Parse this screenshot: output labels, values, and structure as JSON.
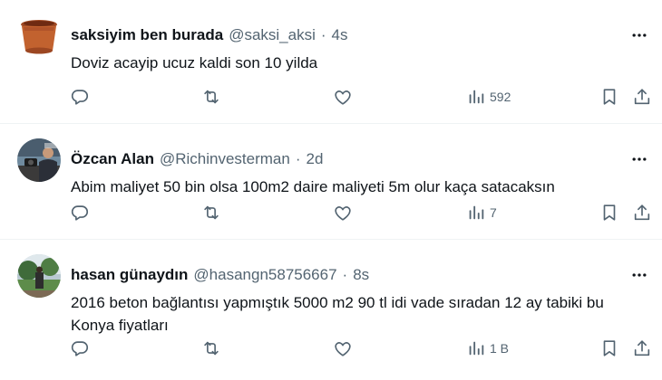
{
  "tweets": [
    {
      "name": "saksiyim ben burada",
      "handle": "@saksi_aksi",
      "sep": "·",
      "time": "4s",
      "text": "Doviz acayip ucuz kaldi son 10 yilda",
      "views": "592",
      "avatar": "flower-pot-avatar"
    },
    {
      "name": "Özcan Alan",
      "handle": "@Richinvesterman",
      "sep": "·",
      "time": "2d",
      "text": "Abim maliyet 50 bin olsa 100m2 daire maliyeti 5m olur kaça satacaksın",
      "views": "7",
      "avatar": "man-with-camera-avatar"
    },
    {
      "name": "hasan günaydın",
      "handle": "@hasangn58756667",
      "sep": "·",
      "time": "8s",
      "text": "2016 beton bağlantısı yapmıştık 5000 m2 90 tl idi  vade sıradan 12 ay tabiki bu Konya fiyatları",
      "views": "1 B",
      "avatar": "park-scene-avatar"
    }
  ],
  "icons": [
    "reply-icon",
    "retweet-icon",
    "like-icon",
    "views-icon",
    "bookmark-icon",
    "share-icon",
    "more-icon"
  ],
  "colors": {
    "text": "#0f1419",
    "secondary": "#536471",
    "divider": "#eff3f4"
  }
}
